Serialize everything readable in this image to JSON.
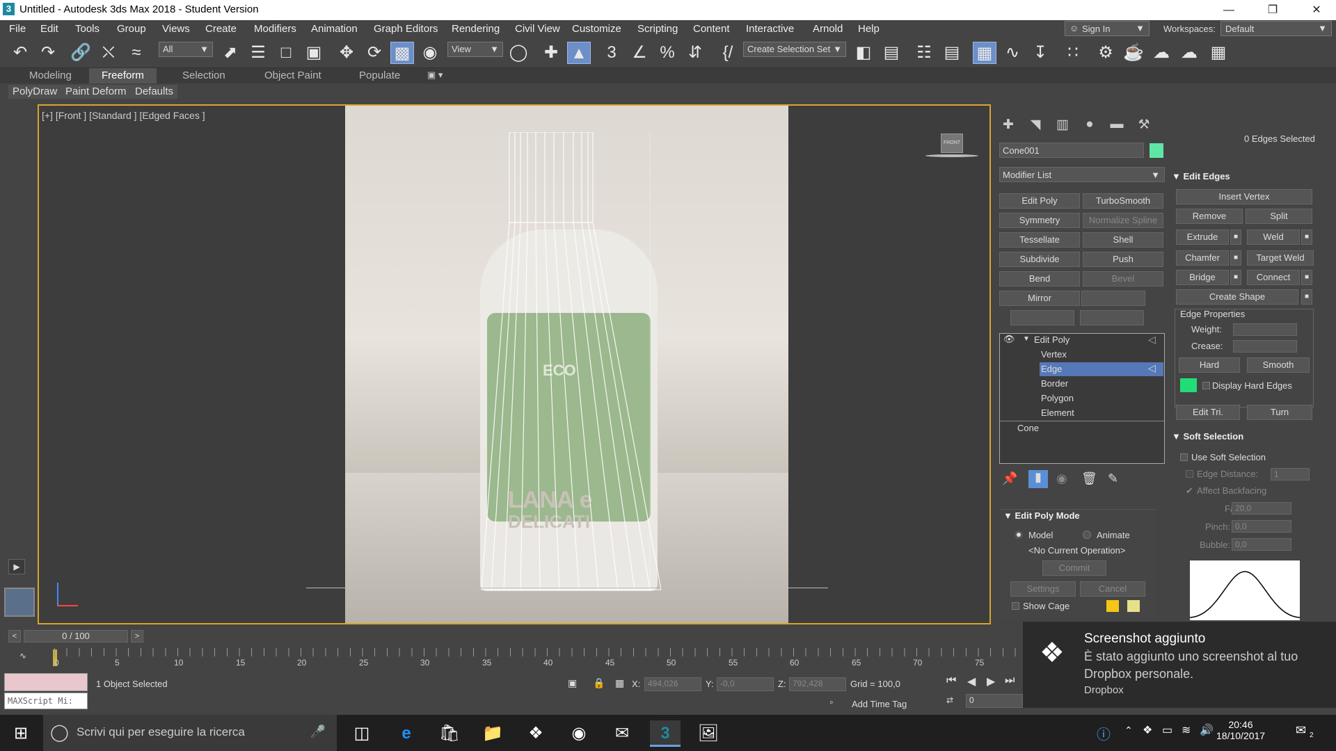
{
  "window": {
    "title": "Untitled - Autodesk 3ds Max 2018 - Student Version",
    "app_icon": "3"
  },
  "menu": [
    "File",
    "Edit",
    "Tools",
    "Group",
    "Views",
    "Create",
    "Modifiers",
    "Animation",
    "Graph Editors",
    "Rendering",
    "Civil View",
    "Customize",
    "Scripting",
    "Content",
    "Interactive",
    "Arnold",
    "Help"
  ],
  "account": {
    "signin": "Sign In",
    "workspaces_label": "Workspaces:",
    "workspace": "Default"
  },
  "toolbar": {
    "filter": "All",
    "ref_coord": "View",
    "selection_set": "Create Selection Set"
  },
  "ribbon": {
    "tabs": [
      "Modeling",
      "Freeform",
      "Selection",
      "Object Paint",
      "Populate"
    ],
    "active_tab": "Freeform",
    "sub": [
      "PolyDraw",
      "Paint Deform",
      "Defaults"
    ]
  },
  "viewport": {
    "label": "[+] [Front ] [Standard ] [Edged Faces ]",
    "viewcube": "FRONT",
    "bottle_text": [
      "ECO",
      "LANA e",
      "DELICATI"
    ]
  },
  "command_panel": {
    "object_name": "Cone001",
    "object_color": "#5fe6a5",
    "modifier_list": "Modifier List",
    "modifier_buttons": [
      [
        "Edit Poly",
        "TurboSmooth"
      ],
      [
        "Symmetry",
        "Normalize Spline"
      ],
      [
        "Tessellate",
        "Shell"
      ],
      [
        "Subdivide",
        "Push"
      ],
      [
        "Bend",
        "Bevel"
      ],
      [
        "Mirror",
        ""
      ],
      [
        "",
        ""
      ]
    ],
    "stack": {
      "edit_poly": "Edit Poly",
      "subobjects": [
        "Vertex",
        "Edge",
        "Border",
        "Polygon",
        "Element"
      ],
      "selected": "Edge",
      "base": "Cone"
    },
    "edit_poly_mode": {
      "title": "Edit Poly Mode",
      "model": "Model",
      "animate": "Animate",
      "operation": "<No Current Operation>",
      "commit": "Commit",
      "settings": "Settings",
      "cancel": "Cancel",
      "show_cage": "Show Cage",
      "cage_colors": [
        "#f5c518",
        "#e6e08a"
      ]
    }
  },
  "edit_edges": {
    "selected_info": "0 Edges Selected",
    "title": "Edit Edges",
    "insert_vertex": "Insert Vertex",
    "remove": "Remove",
    "split": "Split",
    "extrude": "Extrude",
    "weld": "Weld",
    "chamfer": "Chamfer",
    "target_weld": "Target Weld",
    "bridge": "Bridge",
    "connect": "Connect",
    "create_shape": "Create Shape",
    "edge_properties": "Edge Properties",
    "weight": "Weight:",
    "crease": "Crease:",
    "hard": "Hard",
    "smooth": "Smooth",
    "display_hard_edges": "Display Hard Edges",
    "hard_edge_color": "#22dd77",
    "edit_tri": "Edit Tri.",
    "turn": "Turn"
  },
  "soft_selection": {
    "title": "Soft Selection",
    "use_soft": "Use Soft Selection",
    "edge_distance": "Edge Distance:",
    "edge_distance_val": "1",
    "affect_backfacing": "Affect Backfacing",
    "falloff": "Falloff:",
    "falloff_val": "20,0",
    "pinch": "Pinch:",
    "pinch_val": "0,0",
    "bubble": "Bubble:",
    "bubble_val": "0,0"
  },
  "timeline": {
    "frame": "0 / 100",
    "ticks": [
      "0",
      "5",
      "10",
      "15",
      "20",
      "25",
      "30",
      "35",
      "40",
      "45",
      "50",
      "55",
      "60",
      "65",
      "70",
      "75"
    ]
  },
  "status": {
    "selected": "1 Object Selected",
    "maxscript": "MAXScript Mi:",
    "x_label": "X:",
    "x": "494,026",
    "y_label": "Y:",
    "y": "-0,0",
    "z_label": "Z:",
    "z": "792,428",
    "grid": "Grid = 100,0",
    "add_time_tag": "Add Time Tag",
    "frame_field": "0"
  },
  "toast": {
    "title": "Screenshot aggiunto",
    "body": "È stato aggiunto uno screenshot al tuo Dropbox personale.",
    "source": "Dropbox"
  },
  "taskbar": {
    "search": "Scrivi qui per eseguire la ricerca",
    "time": "20:46",
    "date": "18/10/2017",
    "notification_count": "2"
  }
}
